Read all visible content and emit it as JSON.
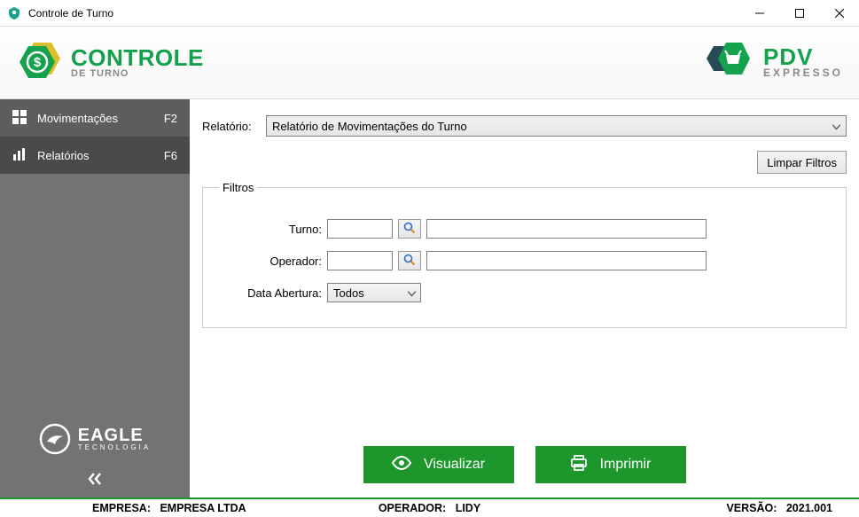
{
  "window": {
    "title": "Controle de Turno"
  },
  "header": {
    "logo_left": {
      "line1": "CONTROLE",
      "line2": "DE TURNO"
    },
    "logo_right": {
      "line1": "PDV",
      "line2": "EXPRESSO"
    }
  },
  "sidebar": {
    "items": [
      {
        "label": "Movimentações",
        "shortcut": "F2",
        "icon": "grid-icon",
        "state": "hover"
      },
      {
        "label": "Relatórios",
        "shortcut": "F6",
        "icon": "bar-chart-icon",
        "state": "active"
      }
    ],
    "eagle": {
      "line1": "EAGLE",
      "line2": "TECNOLOGIA"
    }
  },
  "main": {
    "relatorio_label": "Relatório:",
    "relatorio_value": "Relatório de Movimentações do Turno",
    "limpar_label": "Limpar Filtros",
    "filtros_legend": "Filtros",
    "filtros": {
      "turno_label": "Turno:",
      "turno_code": "",
      "turno_name": "",
      "operador_label": "Operador:",
      "operador_code": "",
      "operador_name": "",
      "data_abertura_label": "Data Abertura:",
      "data_abertura_value": "Todos"
    },
    "actions": {
      "visualizar": "Visualizar",
      "imprimir": "Imprimir"
    }
  },
  "statusbar": {
    "empresa_label": "EMPRESA:",
    "empresa_value": "EMPRESA LTDA",
    "operador_label": "OPERADOR:",
    "operador_value": "LIDY",
    "versao_label": "VERSÃO:",
    "versao_value": "2021.001"
  }
}
